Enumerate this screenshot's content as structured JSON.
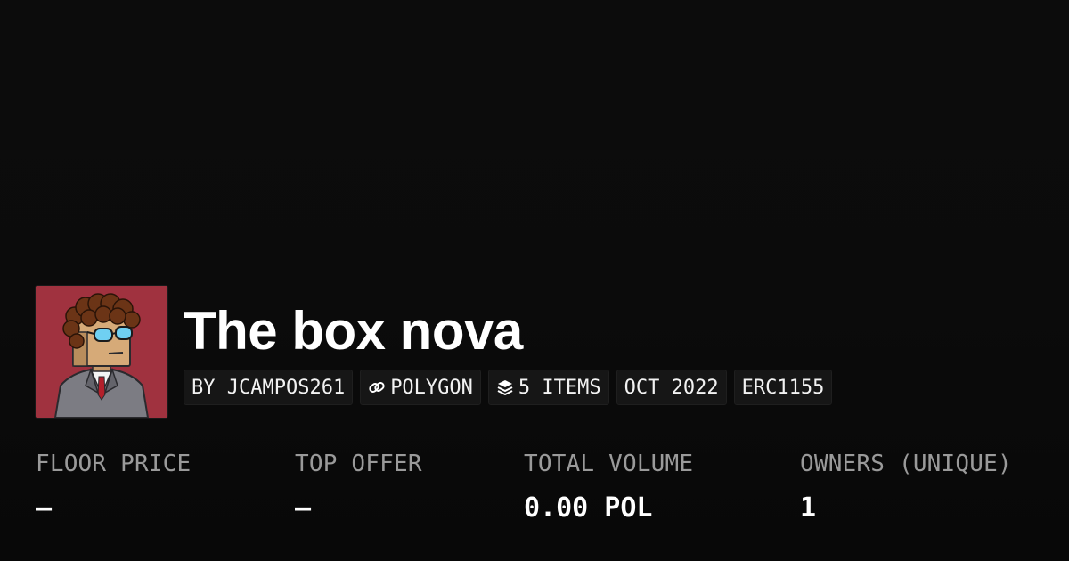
{
  "collection": {
    "title": "The box nova",
    "avatar_icon": "avatar-cartoon-man-icon"
  },
  "chips": {
    "creator": "BY JCAMPOS261",
    "chain": "POLYGON",
    "chain_icon": "link-icon",
    "items": "5 ITEMS",
    "items_icon": "layers-icon",
    "date": "OCT 2022",
    "standard": "ERC1155"
  },
  "stats": {
    "floor_price": {
      "label": "FLOOR PRICE",
      "value": "–"
    },
    "top_offer": {
      "label": "TOP OFFER",
      "value": "–"
    },
    "total_volume": {
      "label": "TOTAL VOLUME",
      "value": "0.00 POL"
    },
    "owners": {
      "label": "OWNERS (UNIQUE)",
      "value": "1"
    }
  },
  "colors": {
    "background": "#0b0b0b",
    "chip_background": "#161616",
    "label": "#9a9a9a",
    "avatar_background": "#a0323f"
  }
}
